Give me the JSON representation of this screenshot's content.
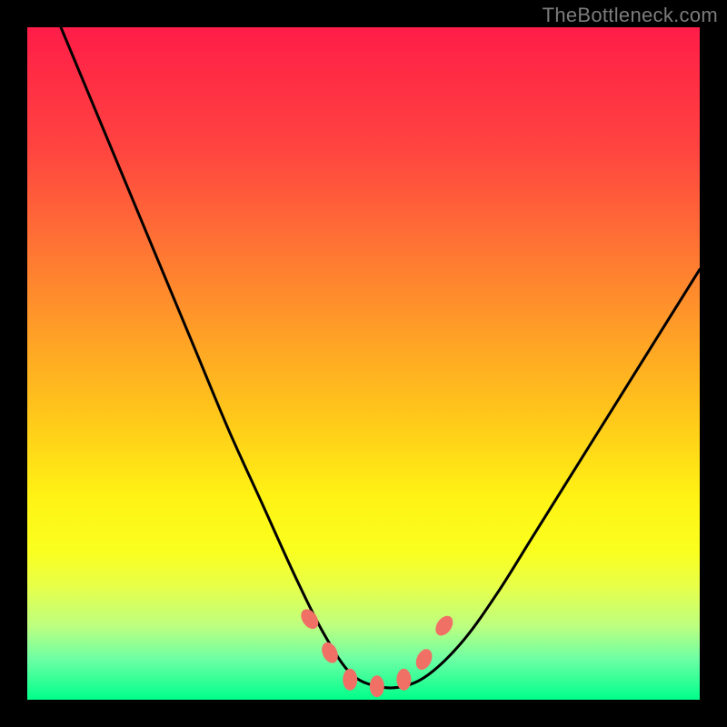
{
  "watermark": "TheBottleneck.com",
  "chart_data": {
    "type": "line",
    "title": "",
    "xlabel": "",
    "ylabel": "",
    "xlim": [
      0,
      100
    ],
    "ylim": [
      0,
      100
    ],
    "series": [
      {
        "name": "curve",
        "x": [
          5,
          10,
          15,
          20,
          25,
          30,
          35,
          40,
          44,
          48,
          52,
          56,
          60,
          65,
          70,
          75,
          80,
          85,
          90,
          95,
          100
        ],
        "values": [
          100,
          88,
          76,
          64,
          52,
          40,
          29,
          18,
          10,
          4,
          2,
          2,
          4,
          9,
          16,
          24,
          32,
          40,
          48,
          56,
          64
        ]
      }
    ],
    "annotations": {
      "trough_markers_x": [
        42,
        45,
        48,
        52,
        56,
        59,
        62
      ],
      "trough_markers_y": [
        12,
        7,
        3,
        2,
        3,
        6,
        11
      ]
    }
  }
}
